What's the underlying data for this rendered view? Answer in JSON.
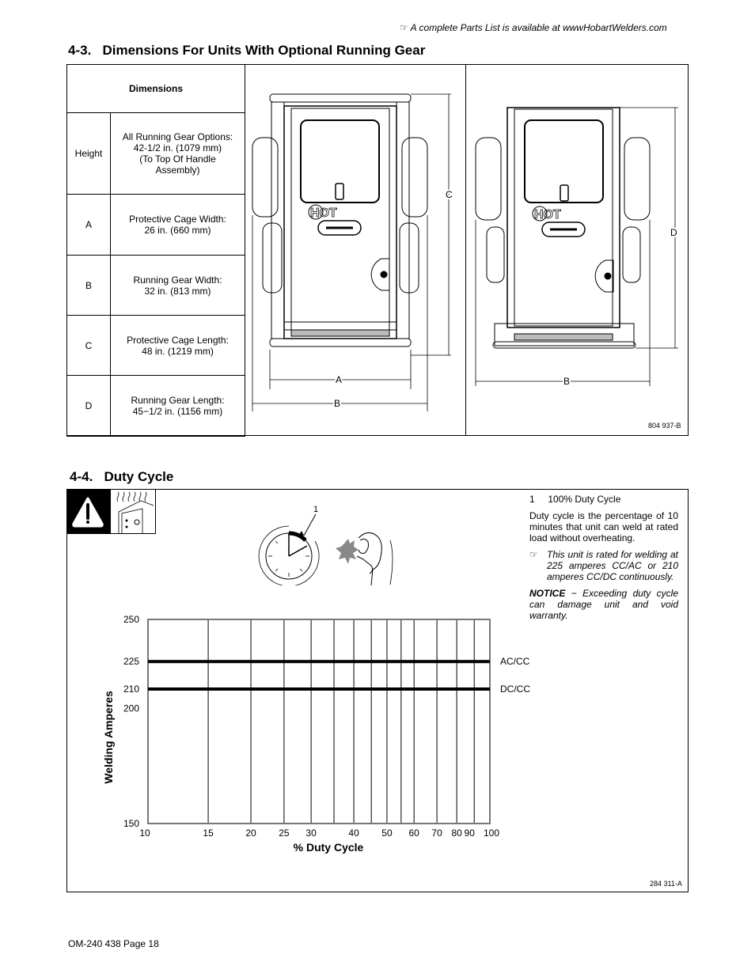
{
  "header": {
    "note_icon": "pointing-hand-icon",
    "note_text": "A complete Parts List is available at wwwHobartWelders.com"
  },
  "section_4_3": {
    "title": "4-3.   Dimensions For Units With Optional Running Gear",
    "table": {
      "header": "Dimensions",
      "rows": [
        {
          "label": "Height",
          "lines": [
            "All Running Gear Options:",
            "42-1/2 in. (1079 mm)",
            "(To Top Of Handle",
            "Assembly)"
          ]
        },
        {
          "label": "A",
          "lines": [
            "Protective Cage Width:",
            "26 in. (660 mm)"
          ]
        },
        {
          "label": "B",
          "lines": [
            "Running Gear Width:",
            "32 in. (813 mm)"
          ]
        },
        {
          "label": "C",
          "lines": [
            "Protective Cage Length:",
            "48 in. (1219 mm)"
          ]
        },
        {
          "label": "D",
          "lines": [
            "Running Gear Length:",
            "45−1/2 in. (1156 mm)"
          ]
        }
      ]
    },
    "figure": {
      "left_view_labels": {
        "width_cage": "A",
        "width_gear": "B",
        "length_cage": "C"
      },
      "right_view_labels": {
        "width_gear": "B",
        "length_gear": "D"
      },
      "hot_label": "HOT",
      "figure_code": "804 937-B"
    }
  },
  "section_4_4": {
    "title": "4-4.   Duty Cycle",
    "callout_number": "1",
    "legend_item": {
      "number": "1",
      "label": "100% Duty Cycle"
    },
    "description": "Duty cycle is the percentage of 10 minutes that unit can weld at rated load without overheating.",
    "rating_note": "This unit is rated for welding at 225 amperes CC/AC or 210 amperes CC/DC continuously.",
    "notice_label": "NOTICE",
    "notice_text": " − Exceeding duty cycle can damage unit and void warranty.",
    "figure_code": "284 311-A"
  },
  "chart_data": {
    "type": "line",
    "title": "",
    "xlabel": "% Duty Cycle",
    "ylabel": "Welding Amperes",
    "x_scale": "log",
    "y_scale": "log",
    "xlim": [
      10,
      100
    ],
    "ylim": [
      150,
      250
    ],
    "x_ticks": [
      10,
      15,
      20,
      25,
      30,
      40,
      50,
      60,
      70,
      80,
      90,
      100
    ],
    "x_gridlines": [
      15,
      20,
      25,
      30,
      35,
      40,
      45,
      50,
      55,
      60,
      70,
      80,
      90
    ],
    "y_ticks": [
      150,
      200,
      210,
      225,
      250
    ],
    "grid": true,
    "series": [
      {
        "name": "AC/CC",
        "x": [
          10,
          100
        ],
        "values": [
          225,
          225
        ]
      },
      {
        "name": "DC/CC",
        "x": [
          10,
          100
        ],
        "values": [
          210,
          210
        ]
      }
    ]
  },
  "footer": {
    "page_label": "OM-240 438 Page 18"
  }
}
